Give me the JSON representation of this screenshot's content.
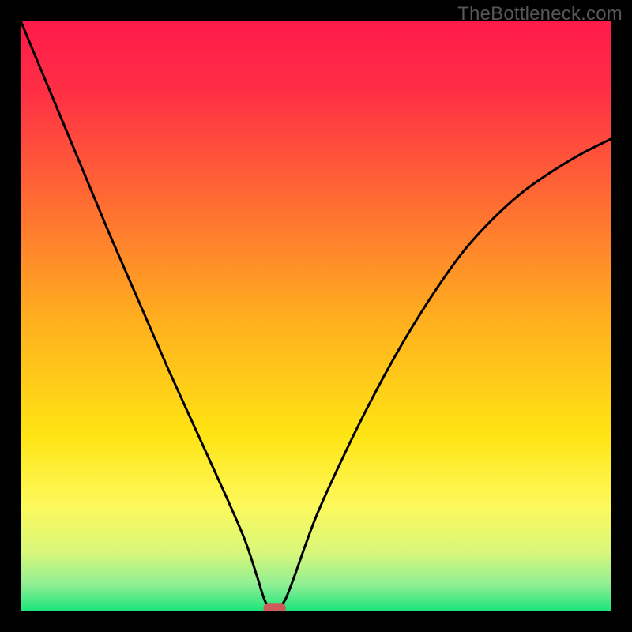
{
  "watermark": "TheBottleneck.com",
  "chart_data": {
    "type": "line",
    "title": "",
    "xlabel": "",
    "ylabel": "",
    "xlim": [
      0,
      100
    ],
    "ylim": [
      0,
      100
    ],
    "series": [
      {
        "name": "curve",
        "x": [
          0,
          5,
          10,
          15,
          20,
          25,
          30,
          35,
          38,
          40,
          41.5,
          43,
          44.5,
          46,
          50,
          55,
          60,
          65,
          70,
          75,
          80,
          85,
          90,
          95,
          100
        ],
        "values": [
          100,
          88,
          76,
          64,
          52.5,
          41,
          30,
          19,
          12,
          6,
          1.5,
          0.5,
          1.5,
          5,
          16,
          27,
          37,
          46,
          54,
          61,
          66.5,
          71,
          74.5,
          77.5,
          80
        ]
      }
    ],
    "marker": {
      "x": 43,
      "y": 0.5
    },
    "gradient_stops": [
      {
        "offset": 0.0,
        "color": "#ff1a4a"
      },
      {
        "offset": 0.12,
        "color": "#ff2f45"
      },
      {
        "offset": 0.3,
        "color": "#ff6a33"
      },
      {
        "offset": 0.5,
        "color": "#ffad1f"
      },
      {
        "offset": 0.7,
        "color": "#ffe413"
      },
      {
        "offset": 0.82,
        "color": "#fdf95b"
      },
      {
        "offset": 0.9,
        "color": "#d8f77a"
      },
      {
        "offset": 0.955,
        "color": "#8fef94"
      },
      {
        "offset": 1.0,
        "color": "#19e37a"
      }
    ],
    "marker_color": "#cf5a5a",
    "curve_color": "#000000"
  }
}
